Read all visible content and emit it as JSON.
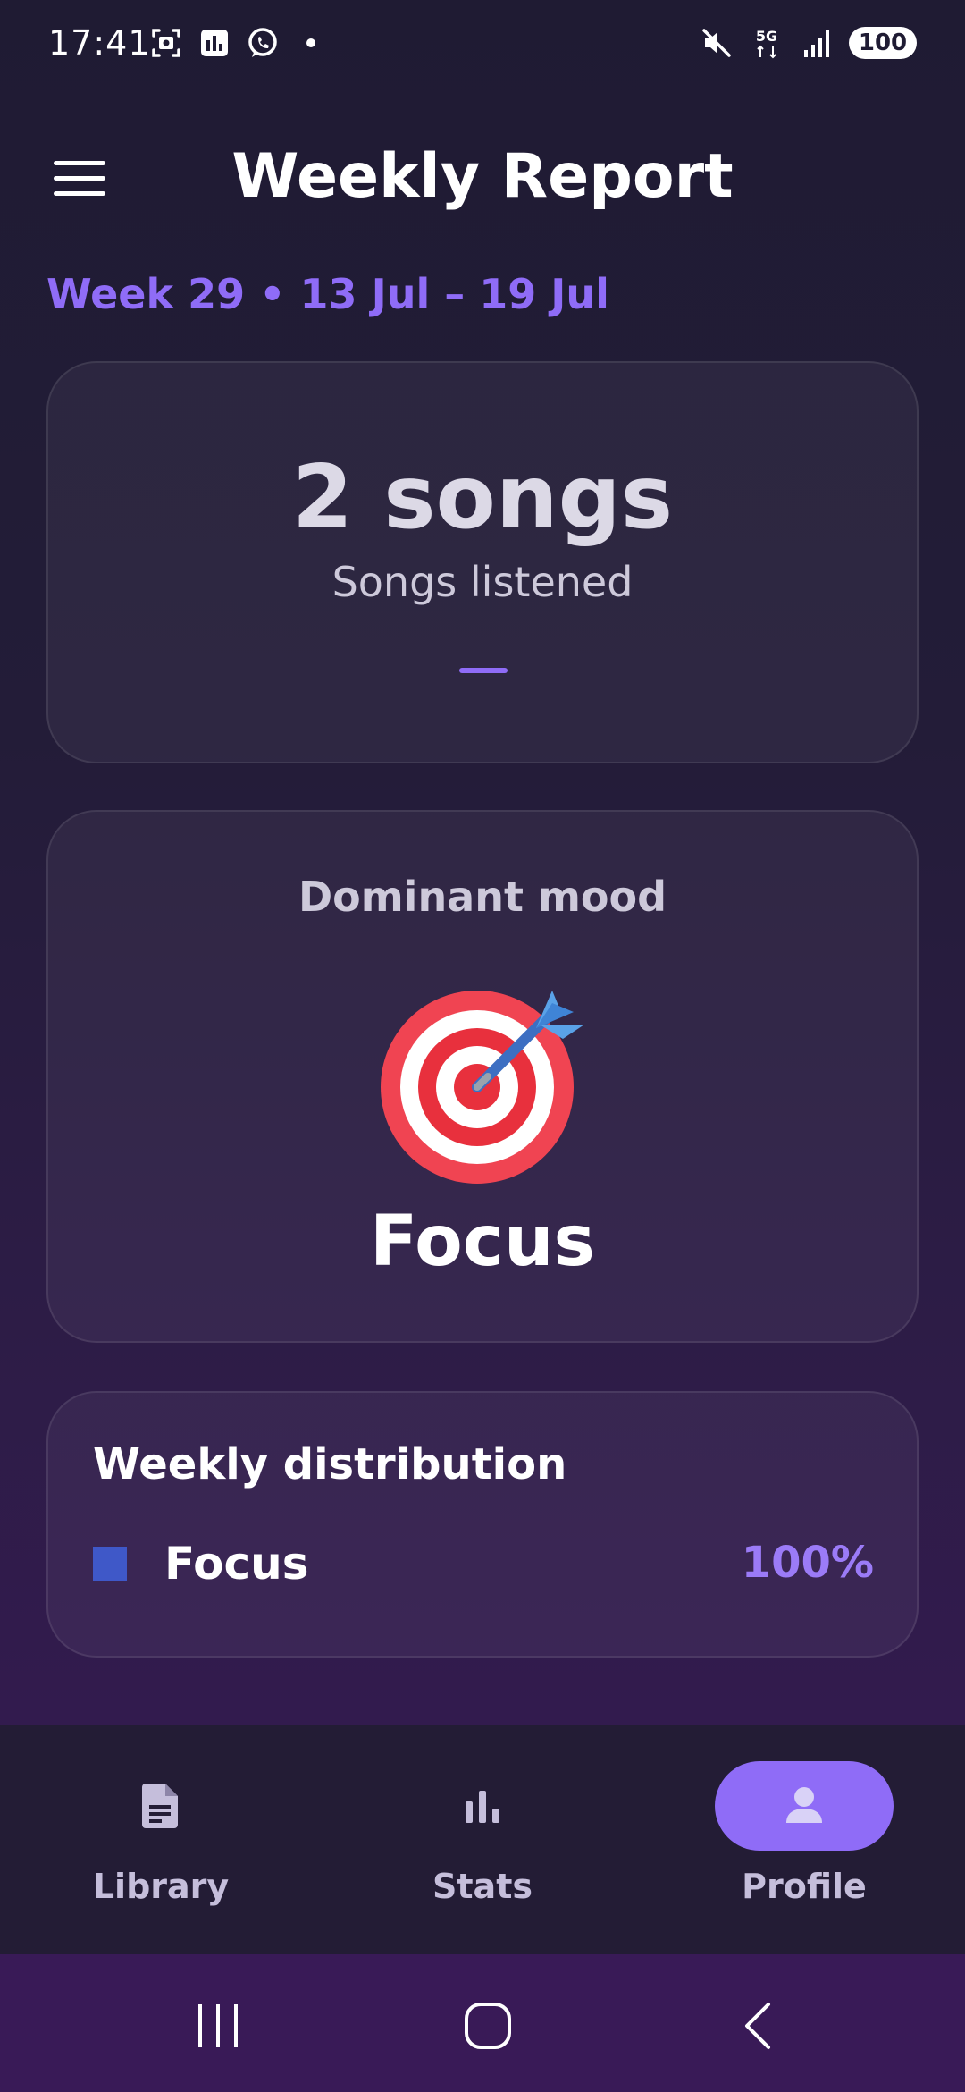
{
  "status_bar": {
    "time": "17:41",
    "network": "5G",
    "battery": "100",
    "icons": [
      "screenshot-icon",
      "stats-notification-icon",
      "whatsapp-icon",
      "dot-icon",
      "mute-icon",
      "network-5g-icon",
      "signal-icon",
      "battery-icon"
    ]
  },
  "header": {
    "title": "Weekly Report",
    "menu_icon": "hamburger-menu-icon"
  },
  "week": {
    "label": "Week 29 • 13 Jul – 19 Jul"
  },
  "songs_card": {
    "count": "2 songs",
    "label": "Songs listened",
    "trend": "—"
  },
  "mood_card": {
    "title": "Dominant mood",
    "emoji_icon": "dart-target-icon",
    "mood": "Focus"
  },
  "distribution_card": {
    "title": "Weekly distribution",
    "items": [
      {
        "label": "Focus",
        "percent": "100%",
        "color": "#3f58c8"
      }
    ]
  },
  "bottom_nav": {
    "active": "Profile",
    "items": [
      {
        "label": "Library",
        "icon": "document-icon"
      },
      {
        "label": "Stats",
        "icon": "bar-chart-icon"
      },
      {
        "label": "Profile",
        "icon": "person-icon"
      }
    ]
  },
  "system_nav": {
    "icons": [
      "recent-apps-icon",
      "home-icon",
      "back-icon"
    ]
  },
  "colors": {
    "accent": "#8f6cf7",
    "background_top": "#1f1b33",
    "background_bottom": "#371a55",
    "nav_background": "#231c35",
    "focus_swatch": "#3f58c8"
  }
}
